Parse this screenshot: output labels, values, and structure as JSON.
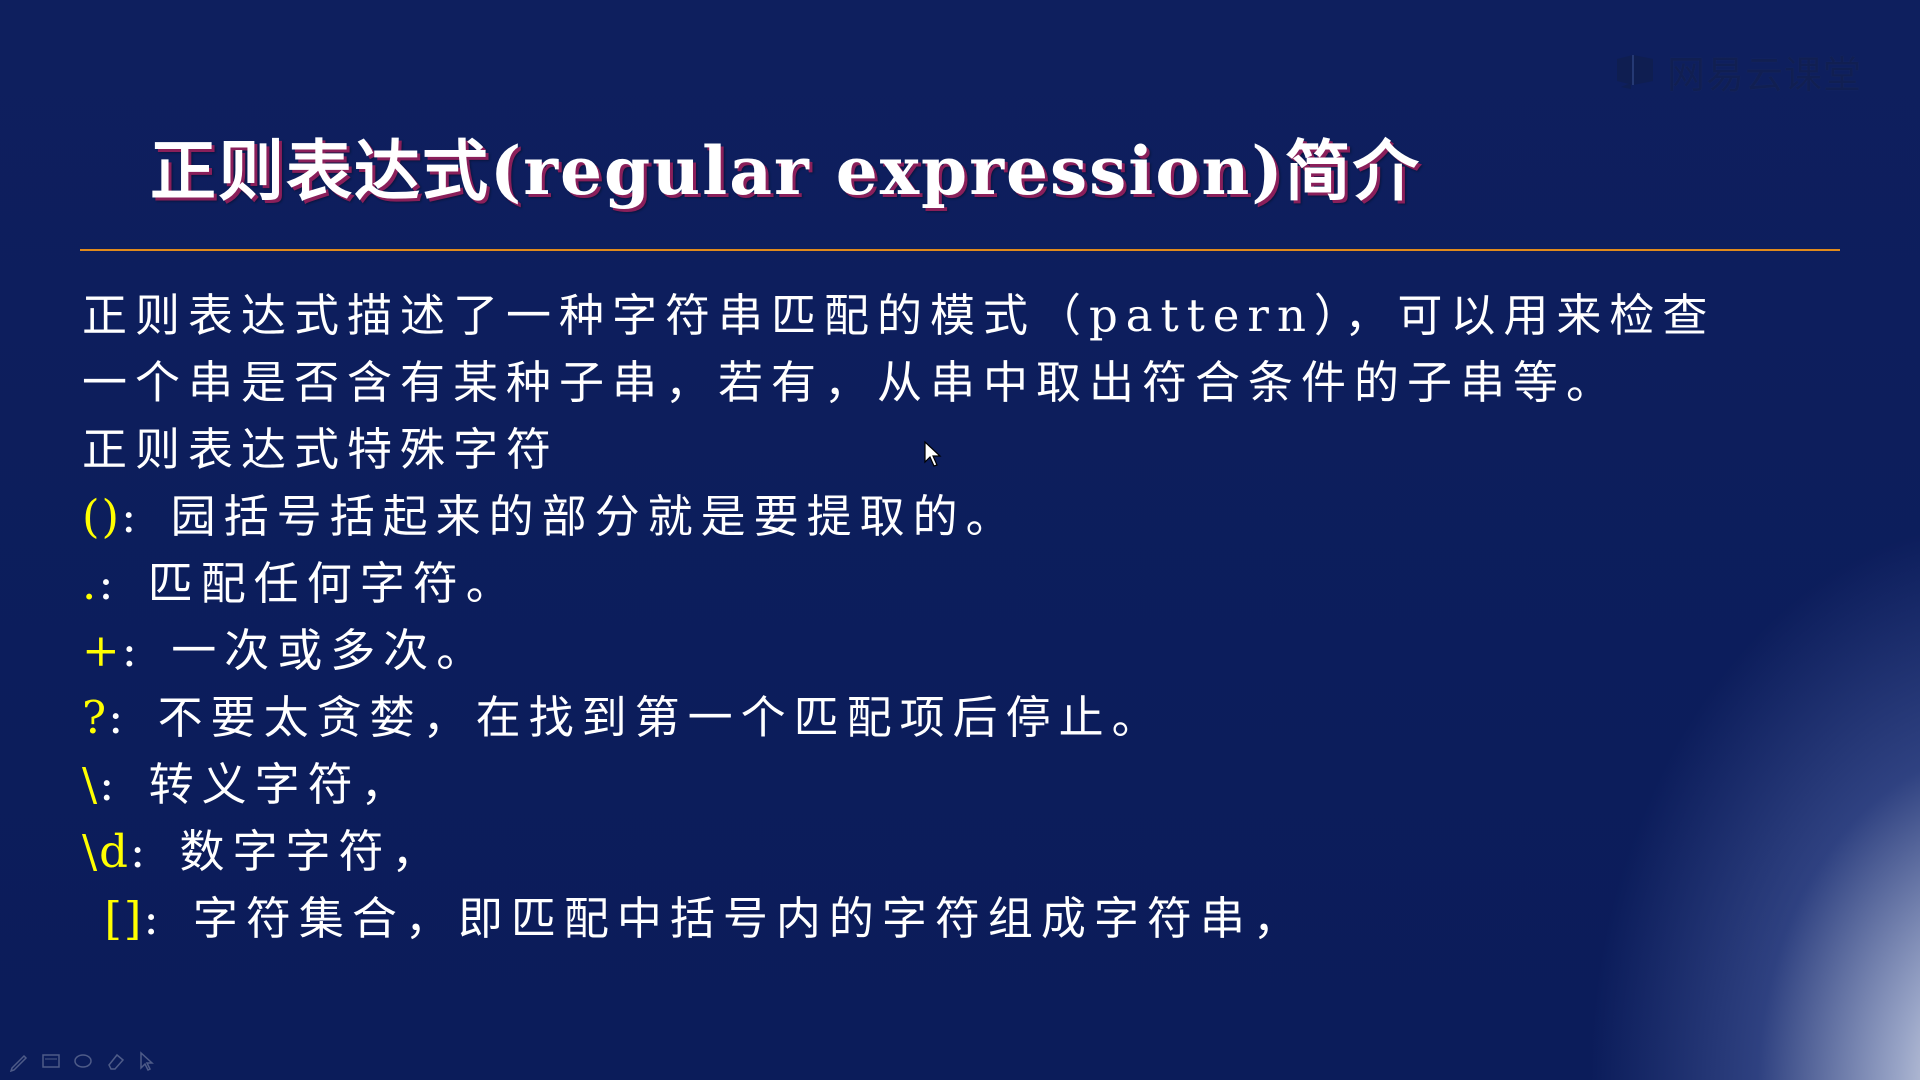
{
  "watermark": {
    "text": "网易云课堂"
  },
  "slide": {
    "title": "正则表达式(regular expression)简介",
    "intro_lines": [
      "正则表达式描述了一种字符串匹配的模式（pattern），可以用来检查",
      "一个串是否含有某种子串，若有，从串中取出符合条件的子串等。",
      "正则表达式特殊字符"
    ],
    "special_chars": [
      {
        "symbol": "()",
        "colon": ":",
        "desc": "园括号括起来的部分就是要提取的。"
      },
      {
        "symbol": ".",
        "colon": ":",
        "desc": "匹配任何字符。"
      },
      {
        "symbol": "+",
        "colon": ":",
        "desc": "一次或多次。"
      },
      {
        "symbol": "?",
        "colon": ":",
        "desc": "不要太贪婪，在找到第一个匹配项后停止。"
      },
      {
        "symbol": "\\",
        "colon": ":",
        "desc": "转义字符，"
      },
      {
        "symbol": "\\d",
        "colon": ":",
        "desc": "数字字符，"
      },
      {
        "symbol": "[]",
        "colon": ":",
        "desc": "字符集合，即匹配中括号内的字符组成字符串，"
      }
    ]
  },
  "colors": {
    "background": "#0d1d5c",
    "divider": "#e08a1c",
    "symbol": "#ffff00",
    "text": "#ffffff"
  },
  "toolbar": {
    "icons": [
      "pen-icon",
      "slides-icon",
      "circle-icon",
      "eraser-icon",
      "pointer-icon"
    ]
  }
}
